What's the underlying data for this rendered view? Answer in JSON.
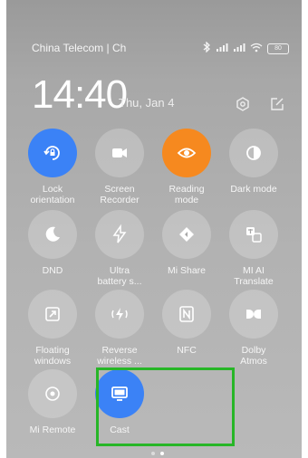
{
  "status_bar": {
    "carrier": "China Telecom | Ch",
    "battery": "80"
  },
  "header": {
    "time": "14:40",
    "date": "Thu, Jan 4"
  },
  "tiles": [
    {
      "label": "Lock\norientation",
      "state": "on",
      "icon": "rotation-lock-icon"
    },
    {
      "label": "Screen\nRecorder",
      "state": "off",
      "icon": "video-camera-icon"
    },
    {
      "label": "Reading\nmode",
      "state": "on",
      "icon": "eye-icon"
    },
    {
      "label": "Dark mode",
      "state": "off",
      "icon": "half-circle-icon"
    },
    {
      "label": "DND",
      "state": "off",
      "icon": "moon-icon"
    },
    {
      "label": "Ultra\nbattery s...",
      "state": "off",
      "icon": "lightning-icon"
    },
    {
      "label": "Mi Share",
      "state": "off",
      "icon": "mi-share-icon"
    },
    {
      "label": "MI AI\nTranslate",
      "state": "off",
      "icon": "translate-icon"
    },
    {
      "label": "Floating\nwindows",
      "state": "off",
      "icon": "floating-window-icon"
    },
    {
      "label": "Reverse\nwireless ...",
      "state": "off",
      "icon": "reverse-charge-icon"
    },
    {
      "label": "NFC",
      "state": "off",
      "icon": "nfc-icon"
    },
    {
      "label": "Dolby\nAtmos",
      "state": "off",
      "icon": "dolby-icon"
    },
    {
      "label": "Mi Remote",
      "state": "off",
      "icon": "remote-icon"
    },
    {
      "label": "Cast",
      "state": "on",
      "icon": "monitor-icon"
    }
  ],
  "colors": {
    "active_blue": "#3b82f6",
    "active_orange": "#f6891f",
    "highlight_green": "#27b627"
  }
}
